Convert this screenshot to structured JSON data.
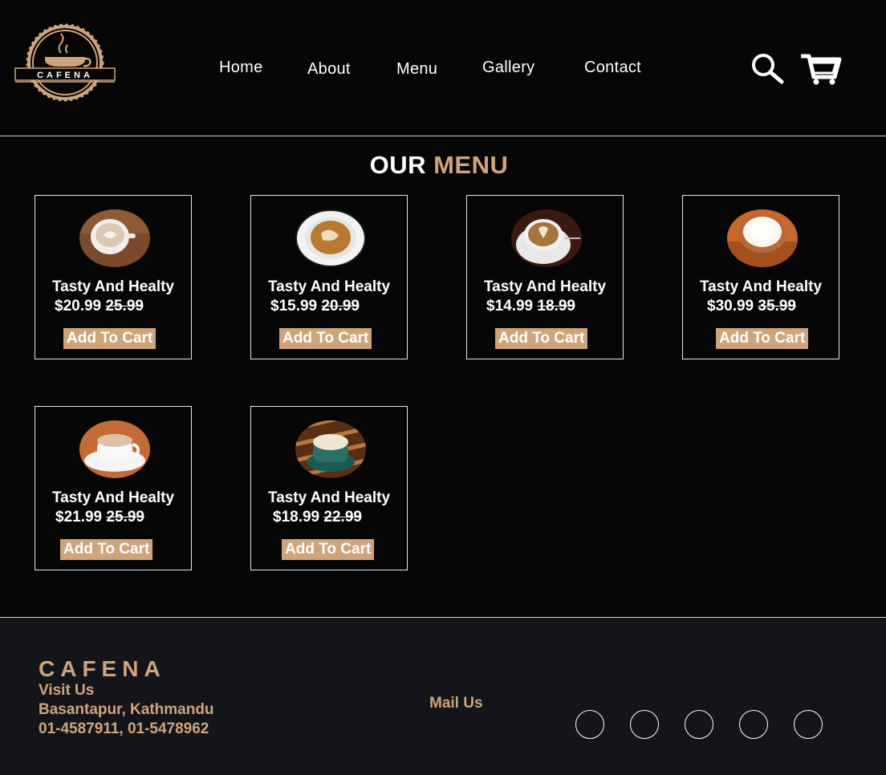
{
  "brand": {
    "logo_text": "CAFENA"
  },
  "nav": {
    "home": "Home",
    "about": "About",
    "menu": "Menu",
    "gallery": "Gallery",
    "contact": "Contact"
  },
  "menu_section": {
    "title_part1": "OUR",
    "title_part2": "MENU"
  },
  "products": [
    {
      "name": "Tasty And Healty",
      "price": "$20.99",
      "old_price": "25.99",
      "button": "Add To Cart"
    },
    {
      "name": "Tasty And Healty",
      "price": "$15.99",
      "old_price": "20.99",
      "button": "Add To Cart"
    },
    {
      "name": "Tasty And Healty",
      "price": "$14.99",
      "old_price": "18.99",
      "button": "Add To Cart"
    },
    {
      "name": "Tasty And Healty",
      "price": "$30.99",
      "old_price": "35.99",
      "button": "Add To Cart"
    },
    {
      "name": "Tasty And Healty",
      "price": "$21.99",
      "old_price": "25.99",
      "button": "Add To Cart"
    },
    {
      "name": "Tasty And Healty",
      "price": "$18.99",
      "old_price": "22.99",
      "button": "Add To Cart"
    }
  ],
  "footer": {
    "brand": "CAFENA",
    "visit_label": "Visit Us",
    "address": "Basantapur, Kathmandu",
    "phones": "01-4587911, 01-5478962",
    "mail_label": "Mail Us"
  },
  "colors": {
    "accent": "#cfa47a",
    "background": "#060606",
    "footer_bg": "#14151a"
  },
  "icons": [
    "coffee-cup-logo-icon",
    "search-icon",
    "cart-icon"
  ]
}
